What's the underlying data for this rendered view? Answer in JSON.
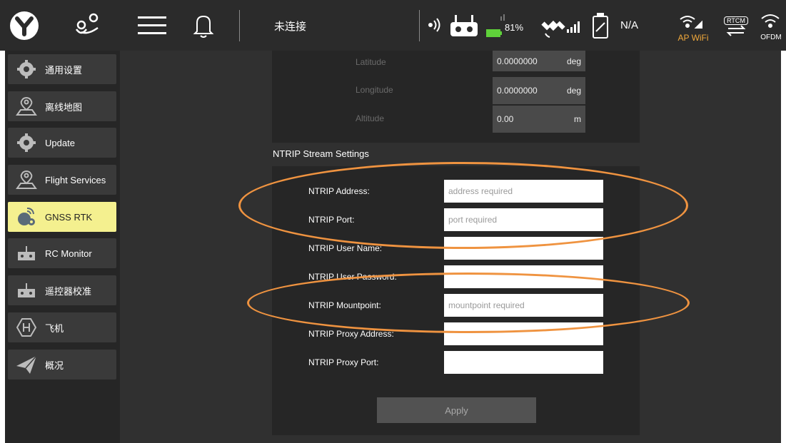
{
  "topbar": {
    "connection_status": "未连接",
    "battery_percent": "81%",
    "gps_value": "N/A",
    "wifi_label": "AP WiFi",
    "rtcm_label": "RTCM",
    "ofdm_label": "OFDM",
    "colors": {
      "background": "#2b2b2b",
      "battery": "#5fd13a",
      "wifi": "#f2a93b"
    }
  },
  "sidebar": {
    "items": [
      {
        "label": "通用设置",
        "icon": "gear-icon"
      },
      {
        "label": "离线地图",
        "icon": "map-pin-icon"
      },
      {
        "label": "Update",
        "icon": "gear-icon"
      },
      {
        "label": "Flight Services",
        "icon": "map-pin-icon"
      },
      {
        "label": "GNSS RTK",
        "icon": "satellite-icon",
        "active": true
      },
      {
        "label": "RC Monitor",
        "icon": "controller-icon"
      },
      {
        "label": "遥控器校准",
        "icon": "controller-icon"
      },
      {
        "label": "飞机",
        "icon": "hexagon-h-icon"
      },
      {
        "label": "概况",
        "icon": "paper-plane-icon"
      }
    ],
    "colors": {
      "active_bg": "#f4f08f"
    }
  },
  "position": {
    "latitude_label": "Latitude",
    "latitude_value": "0.0000000",
    "latitude_unit": "deg",
    "longitude_label": "Longitude",
    "longitude_value": "0.0000000",
    "longitude_unit": "deg",
    "altitude_label": "Altitude",
    "altitude_value": "0.00",
    "altitude_unit": "m"
  },
  "ntrip": {
    "section_title": "NTRIP Stream Settings",
    "address_label": "NTRIP Address:",
    "address_placeholder": "address required",
    "port_label": "NTRIP Port:",
    "port_placeholder": "port required",
    "username_label": "NTRIP User Name:",
    "password_label": "NTRIP User Password:",
    "mountpoint_label": "NTRIP Mountpoint:",
    "mountpoint_placeholder": "mountpoint required",
    "proxy_address_label": "NTRIP Proxy Address:",
    "proxy_port_label": "NTRIP Proxy Port:",
    "apply_label": "Apply"
  },
  "annotation_color": "#ef9340"
}
